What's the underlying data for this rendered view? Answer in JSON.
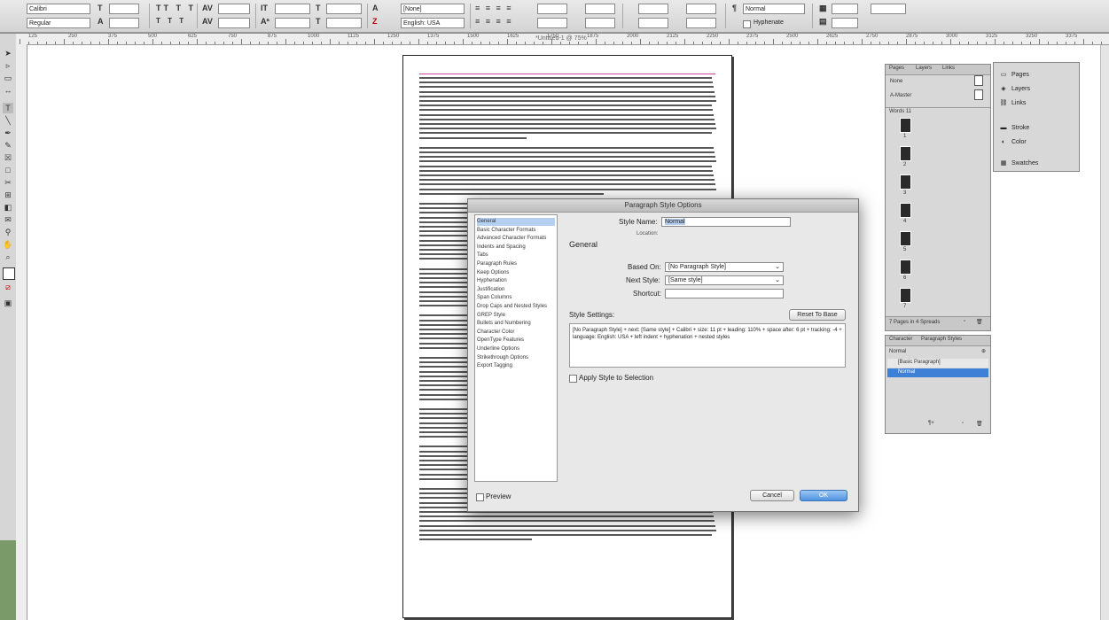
{
  "control_bar": {
    "font_family": "Calibri",
    "font_style": "Regular",
    "language": "English: USA",
    "paragraph_style": "Normal",
    "character_style": "[None]",
    "hyphenate_label": "Hyphenate"
  },
  "ruler": {
    "top_numbers": [
      "125",
      "250",
      "375",
      "500",
      "625",
      "750",
      "875",
      "1000",
      "1125",
      "1250",
      "1375",
      "1500",
      "1625",
      "1750",
      "1875",
      "2000",
      "2125",
      "2250",
      "2375",
      "2500",
      "2625",
      "2750",
      "2875",
      "3000",
      "3125",
      "3250",
      "3375"
    ]
  },
  "document": {
    "tab_title": "*Untitled-1 @ 75%"
  },
  "dialog": {
    "title": "Paragraph Style Options",
    "categories": [
      "General",
      "Basic Character Formats",
      "Advanced Character Formats",
      "Indents and Spacing",
      "Tabs",
      "Paragraph Rules",
      "Keep Options",
      "Hyphenation",
      "Justification",
      "Span Columns",
      "Drop Caps and Nested Styles",
      "GREP Style",
      "Bullets and Numbering",
      "Character Color",
      "OpenType Features",
      "Underline Options",
      "Strikethrough Options",
      "Export Tagging"
    ],
    "selected_category": "General",
    "style_name_label": "Style Name:",
    "style_name_value": "Normal",
    "location_label": "Location:",
    "section_heading": "General",
    "based_on_label": "Based On:",
    "based_on_value": "[No Paragraph Style]",
    "next_style_label": "Next Style:",
    "next_style_value": "[Same style]",
    "shortcut_label": "Shortcut:",
    "shortcut_value": "",
    "style_settings_label": "Style Settings:",
    "reset_button": "Reset To Base",
    "style_settings_text": "[No Paragraph Style] + next: [Same style] + Calibri + size: 11 pt + leading: 110% + space after: 6 pt + tracking: -4 + language: English: USA + left indent + hyphenation + nested styles",
    "apply_label": "Apply Style to Selection",
    "preview_label": "Preview",
    "cancel_button": "Cancel",
    "ok_button": "OK"
  },
  "pages_panel": {
    "tabs": [
      "Pages",
      "Layers",
      "Links"
    ],
    "none_label": "None",
    "master_label": "A-Master",
    "section_label": "Words 11",
    "page_numbers": [
      "1",
      "2",
      "3",
      "4",
      "5",
      "6",
      "7"
    ],
    "footer_text": "7 Pages in 4 Spreads"
  },
  "styles_panel": {
    "tabs": [
      "Character",
      "Paragraph Styles"
    ],
    "current": "Normal",
    "items": [
      "[Basic Paragraph]",
      "Normal"
    ],
    "selected": "Normal"
  },
  "right_panel": {
    "items": [
      {
        "icon": "pages-icon",
        "label": "Pages"
      },
      {
        "icon": "layers-icon",
        "label": "Layers"
      },
      {
        "icon": "links-icon",
        "label": "Links"
      },
      {
        "icon": "stroke-icon",
        "label": "Stroke"
      },
      {
        "icon": "color-icon",
        "label": "Color"
      },
      {
        "icon": "swatches-icon",
        "label": "Swatches"
      }
    ]
  }
}
